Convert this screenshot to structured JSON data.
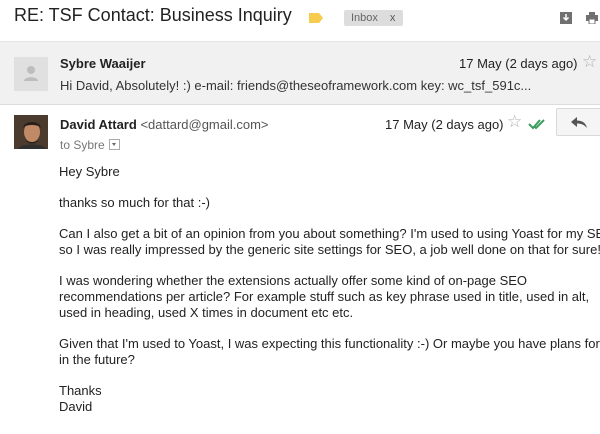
{
  "thread": {
    "subject": "RE: TSF Contact: Business Inquiry",
    "label": "Inbox",
    "label_remove": "x"
  },
  "toolbar": {
    "icons": [
      "download-icon",
      "print-icon"
    ]
  },
  "collapsed_message": {
    "sender": "Sybre Waaijer",
    "date": "17 May (2 days ago)",
    "snippet": "Hi David, Absolutely! :) e-mail: friends@theseoframework.com key: wc_tsf_591c..."
  },
  "message": {
    "sender_name": "David Attard",
    "sender_email": "<dattard@gmail.com>",
    "date": "17 May (2 days ago)",
    "to": "to Sybre",
    "paragraphs": [
      "Hey Sybre",
      "thanks so much for that :-)",
      "Can I also get a bit of an opinion from you about something? I'm used to using Yoast for my SEO,\nso I was really impressed by the generic site settings for SEO, a job well done on that for sure!",
      "I was wondering whether the extensions actually offer some kind of on-page SEO\nrecommendations per article? For example stuff such as key phrase used in title, used in alt,\nused in heading, used X times in document etc etc.",
      "Given that I'm used to Yoast, I was expecting this functionality :-) Or maybe you have plans for it\nin the future?"
    ],
    "signoff": "Thanks\nDavid"
  },
  "colors": {
    "label_tag": "#f7cb4d",
    "check": "#3a9d5d",
    "collapsed_bg": "#f1f1f1"
  }
}
